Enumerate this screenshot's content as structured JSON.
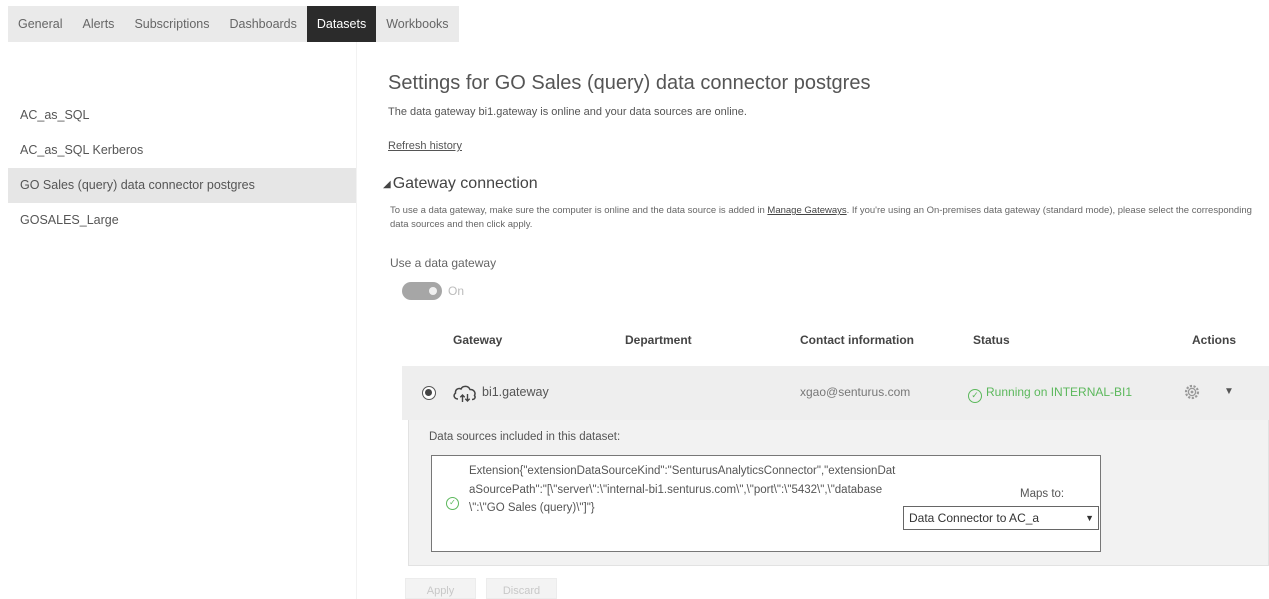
{
  "tabs": [
    {
      "label": "General",
      "active": false
    },
    {
      "label": "Alerts",
      "active": false
    },
    {
      "label": "Subscriptions",
      "active": false
    },
    {
      "label": "Dashboards",
      "active": false
    },
    {
      "label": "Datasets",
      "active": true
    },
    {
      "label": "Workbooks",
      "active": false
    }
  ],
  "sidebar": {
    "items": [
      {
        "label": "AC_as_SQL",
        "active": false
      },
      {
        "label": "AC_as_SQL Kerberos",
        "active": false
      },
      {
        "label": "GO Sales (query) data connector postgres",
        "active": true
      },
      {
        "label": "GOSALES_Large",
        "active": false
      }
    ]
  },
  "main": {
    "title": "Settings for GO Sales (query) data connector postgres",
    "subtitle": "The data gateway bi1.gateway is online and your data sources are online.",
    "refresh_link": "Refresh history",
    "gateway_section": {
      "heading": "Gateway connection",
      "description_before": "To use a data gateway, make sure the computer is online and the data source is added in ",
      "description_link": "Manage Gateways",
      "description_after": ". If you're using an On-premises data gateway (standard mode), please select the corresponding data sources and then click apply.",
      "use_gateway_label": "Use a data gateway",
      "toggle_state": "On"
    },
    "gateway_table": {
      "headers": {
        "gateway": "Gateway",
        "department": "Department",
        "contact": "Contact information",
        "status": "Status",
        "actions": "Actions"
      },
      "rows": [
        {
          "name": "bi1.gateway",
          "department": "",
          "contact": "xgao@senturus.com",
          "status": "Running on INTERNAL-BI1",
          "selected": true
        }
      ]
    },
    "data_sources": {
      "label": "Data sources included in this dataset:",
      "items": [
        {
          "text": "Extension{\"extensionDataSourceKind\":\"SenturusAnalyticsConnector\",\"extensionDataSourcePath\":\"[\\\"server\\\":\\\"internal-bi1.senturus.com\\\",\\\"port\\\":\\\"5432\\\",\\\"database\\\":\\\"GO Sales (query)\\\"]\"}",
          "maps_to_label": "Maps to:",
          "maps_to_value": "Data Connector to AC_a"
        }
      ]
    },
    "buttons": {
      "apply": "Apply",
      "discard": "Discard"
    }
  },
  "colors": {
    "active_tab_bg": "#2b2b2b",
    "status_ok": "#5cb85c",
    "row_bg": "#eeeeee"
  }
}
